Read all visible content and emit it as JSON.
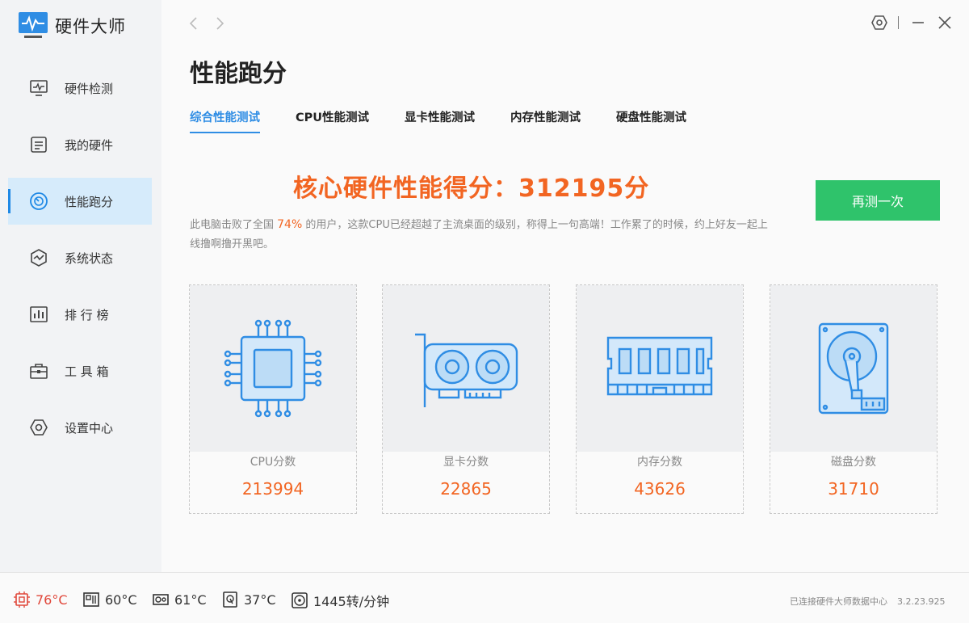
{
  "app": {
    "name": "硬件大师"
  },
  "colors": {
    "accent": "#2f8de4",
    "score": "#f26522",
    "retest": "#2fc36b",
    "hot": "#e0473a"
  },
  "sidebar": {
    "items": [
      {
        "label": "硬件检测",
        "icon": "monitor-icon",
        "active": false
      },
      {
        "label": "我的硬件",
        "icon": "hardware-list-icon",
        "active": false
      },
      {
        "label": "性能跑分",
        "icon": "speedometer-icon",
        "active": true
      },
      {
        "label": "系统状态",
        "icon": "system-status-icon",
        "active": false
      },
      {
        "label": "排 行 榜",
        "icon": "ranking-icon",
        "active": false
      },
      {
        "label": "工 具 箱",
        "icon": "toolbox-icon",
        "active": false
      },
      {
        "label": "设置中心",
        "icon": "settings-hex-icon",
        "active": false
      }
    ]
  },
  "page": {
    "title": "性能跑分",
    "tabs": [
      "综合性能测试",
      "CPU性能测试",
      "显卡性能测试",
      "内存性能测试",
      "硬盘性能测试"
    ],
    "active_tab": 0,
    "headline": "核心硬件性能得分：312195分",
    "retest_label": "再测一次",
    "desc_pre": "此电脑击败了全国 ",
    "desc_pct": "74%",
    "desc_post": " 的用户，这款CPU已经超越了主流桌面的级别，称得上一句高端！工作累了的时候，约上好友一起上线撸啊撸开黑吧。"
  },
  "cards": [
    {
      "label": "CPU分数",
      "value": "213994",
      "icon": "cpu-chip-icon"
    },
    {
      "label": "显卡分数",
      "value": "22865",
      "icon": "graphics-card-icon"
    },
    {
      "label": "内存分数",
      "value": "43626",
      "icon": "memory-module-icon"
    },
    {
      "label": "磁盘分数",
      "value": "31710",
      "icon": "hard-disk-icon"
    }
  ],
  "status": {
    "cpu_temp": "76°C",
    "board_temp": "60°C",
    "gpu_temp": "61°C",
    "disk_temp": "37°C",
    "fan_speed": "1445转/分钟",
    "connection": "已连接硬件大师数据中心",
    "version": "3.2.23.925"
  }
}
